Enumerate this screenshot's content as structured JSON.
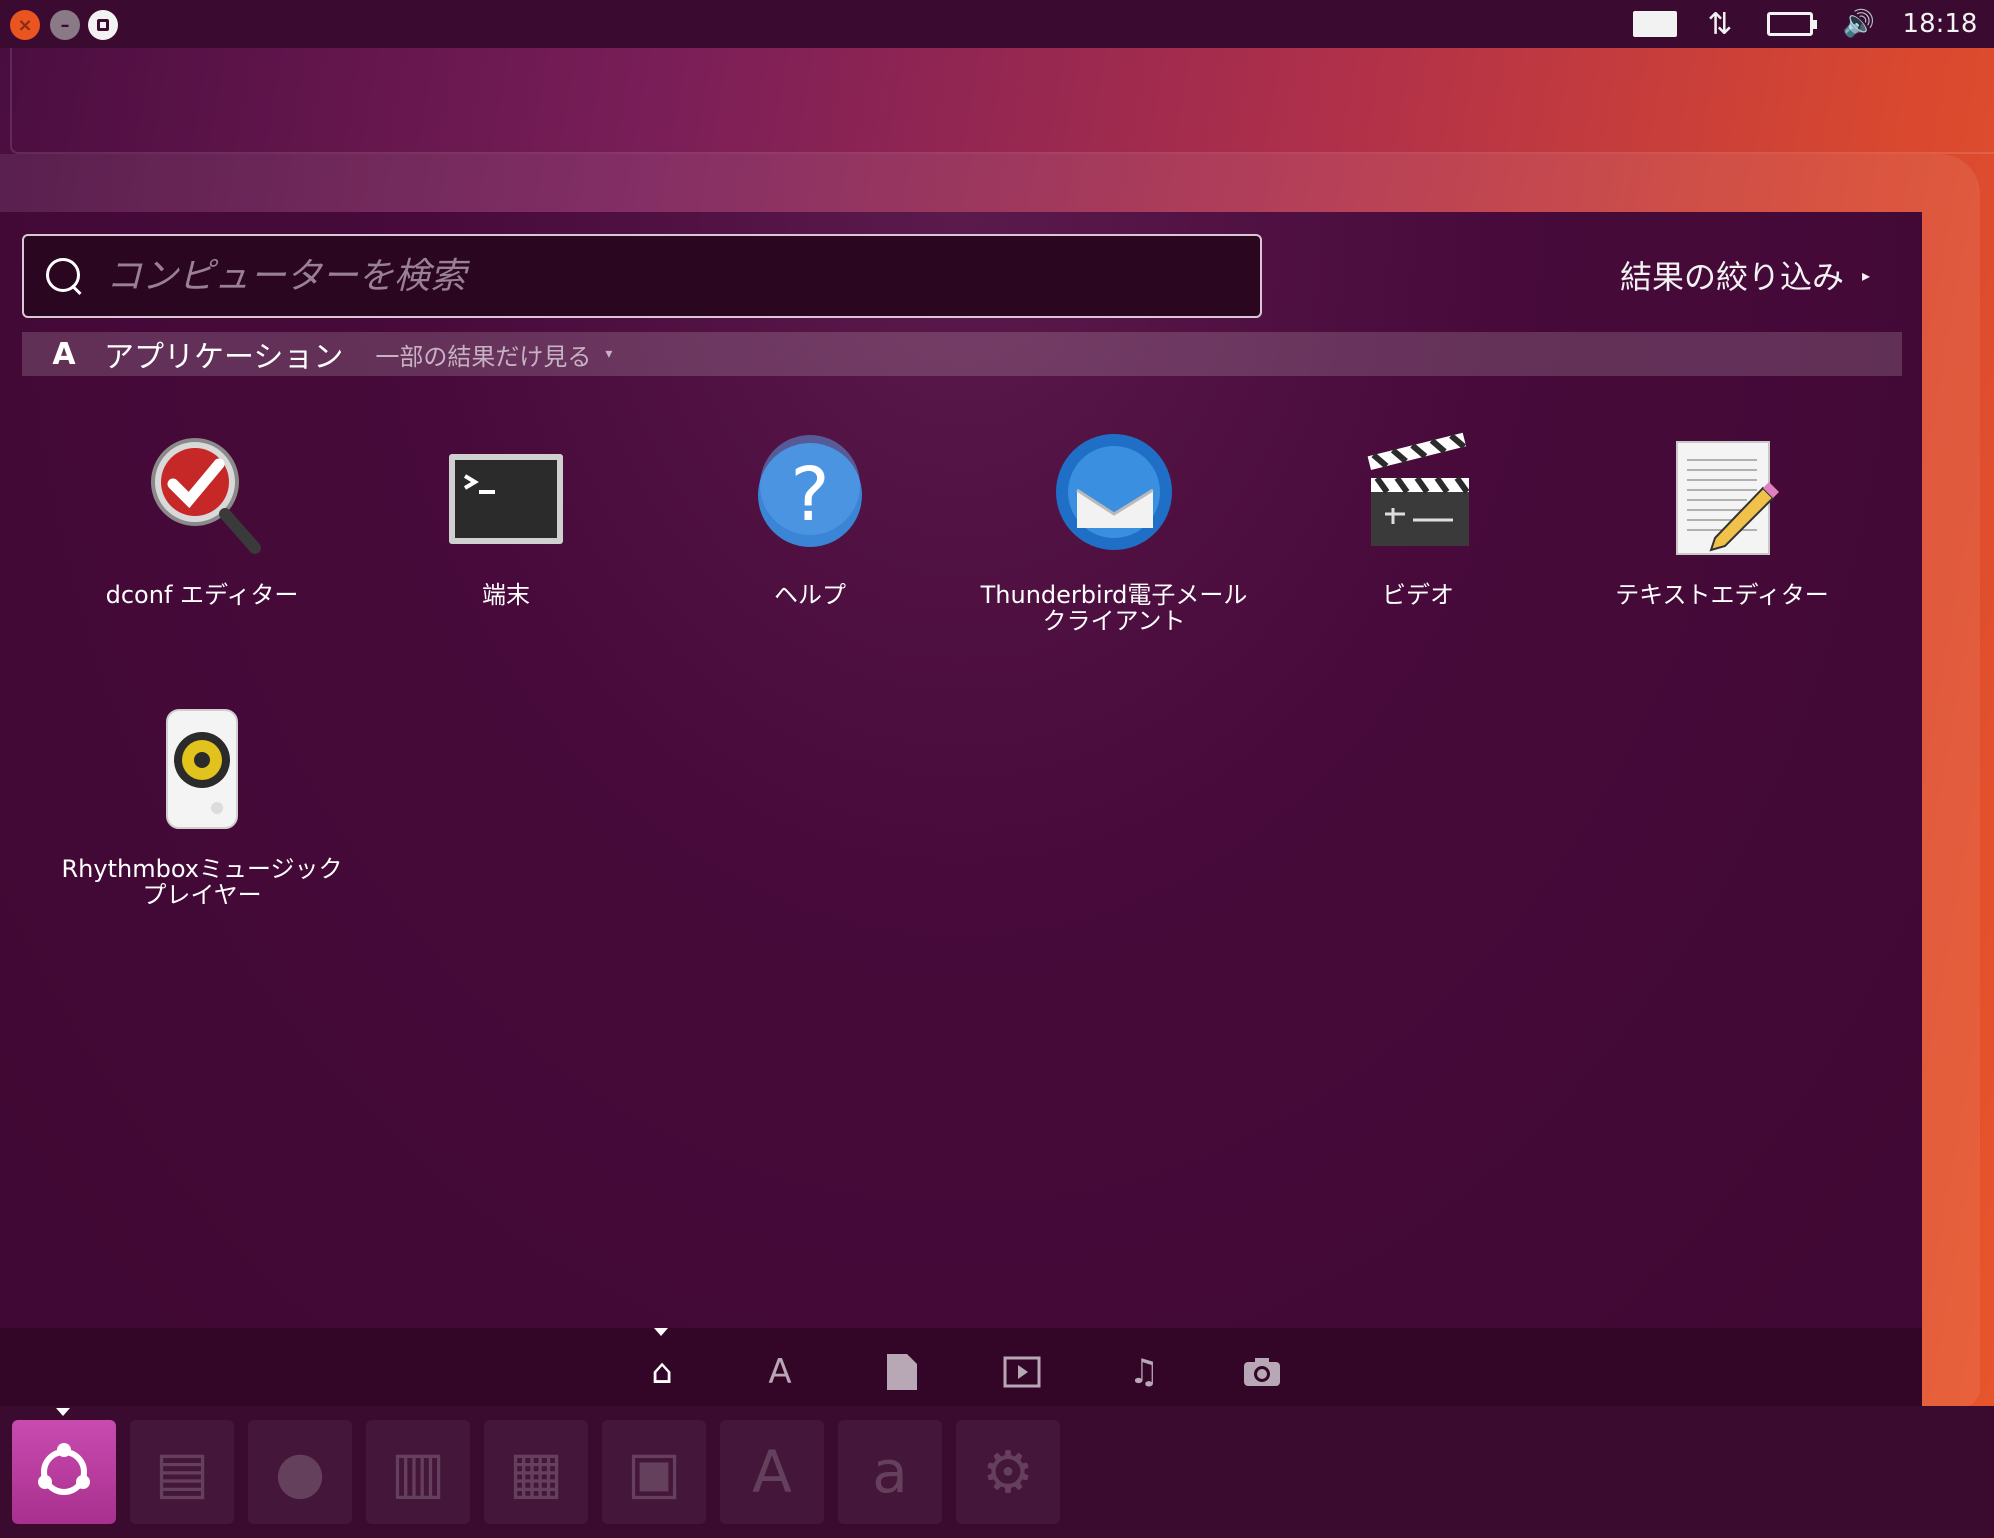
{
  "top_panel": {
    "window_buttons": [
      "close-icon",
      "minimize-icon",
      "maximize-icon"
    ],
    "indicators": {
      "keyboard": "keyboard-icon",
      "network": "network-updown-icon",
      "battery": "battery-icon",
      "volume": "volume-icon"
    },
    "clock": "18:18"
  },
  "search": {
    "placeholder": "コンピューターを検索",
    "value": ""
  },
  "filter": {
    "label": "結果の絞り込み",
    "arrow": "▸"
  },
  "category": {
    "title": "アプリケーション",
    "more_label": "一部の結果だけ見る",
    "more_arrow": "▾"
  },
  "apps": [
    {
      "label": "dconf エディター",
      "icon": "dconf-icon"
    },
    {
      "label": "端末",
      "icon": "terminal-icon"
    },
    {
      "label": "ヘルプ",
      "icon": "help-icon"
    },
    {
      "label": "Thunderbird電子メール\nクライアント",
      "icon": "thunderbird-icon"
    },
    {
      "label": "ビデオ",
      "icon": "video-clapper-icon"
    },
    {
      "label": "テキストエディター",
      "icon": "text-editor-icon"
    },
    {
      "label": "Rhythmboxミュージック\nプレイヤー",
      "icon": "speaker-icon"
    }
  ],
  "scopes": [
    {
      "name": "home",
      "icon": "home-icon",
      "active": true
    },
    {
      "name": "applications",
      "icon": "applications-icon",
      "active": false
    },
    {
      "name": "files",
      "icon": "file-icon",
      "active": false
    },
    {
      "name": "video",
      "icon": "video-icon",
      "active": false
    },
    {
      "name": "music",
      "icon": "music-icon",
      "active": false
    },
    {
      "name": "photos",
      "icon": "camera-icon",
      "active": false
    }
  ],
  "launcher": [
    {
      "icon": "ubuntu-logo-icon",
      "active": true
    },
    {
      "icon": "files-icon"
    },
    {
      "icon": "firefox-icon"
    },
    {
      "icon": "writer-icon"
    },
    {
      "icon": "calc-icon"
    },
    {
      "icon": "impress-icon"
    },
    {
      "icon": "software-center-icon"
    },
    {
      "icon": "amazon-icon"
    },
    {
      "icon": "system-settings-icon"
    }
  ],
  "colors": {
    "dash_bg": "#470a3a",
    "accent": "#e95420",
    "launcher_active": "#c94bb0"
  }
}
